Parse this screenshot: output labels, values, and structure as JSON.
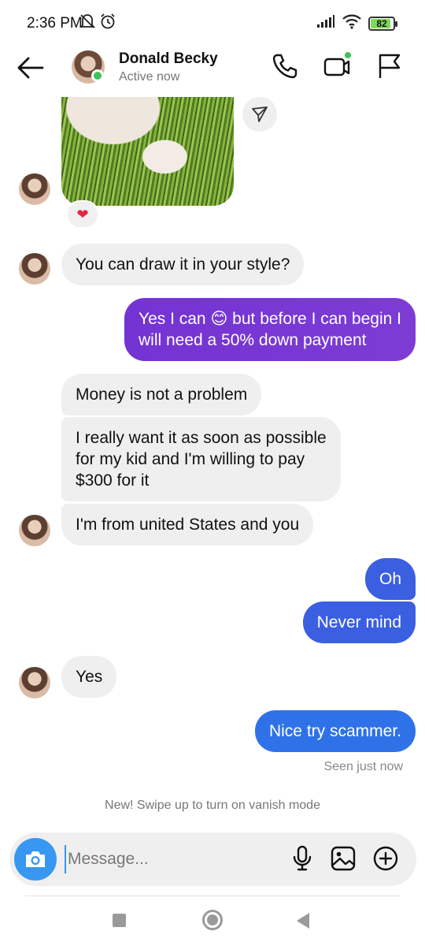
{
  "status_bar": {
    "time": "2:36 PM",
    "battery_level": "82",
    "battery_fraction": 0.82
  },
  "header": {
    "name": "Donald Becky",
    "status": "Active now"
  },
  "chat": {
    "reaction": "❤",
    "messages": [
      {
        "sender": "them",
        "text": "You can draw it in your style?"
      },
      {
        "sender": "me",
        "lines": [
          "Yes I can 😊 but before I can begin I",
          "will need a 50% down payment"
        ]
      },
      {
        "sender": "them",
        "text": "Money is not a problem"
      },
      {
        "sender": "them",
        "lines": [
          "I really want it as soon as possible",
          "for my kid and I'm willing to pay",
          "$300 for it"
        ]
      },
      {
        "sender": "them",
        "text": "I'm from united States and you"
      },
      {
        "sender": "me",
        "text": "Oh"
      },
      {
        "sender": "me",
        "text": "Never mind"
      },
      {
        "sender": "them",
        "text": "Yes"
      },
      {
        "sender": "me",
        "text": "Nice try scammer."
      }
    ],
    "seen_text": "Seen just now",
    "vanish_text": "New! Swipe up to turn on vanish mode"
  },
  "composer": {
    "placeholder": "Message...",
    "value": ""
  },
  "icons": {
    "status_left": [
      "mute-icon",
      "alarm-icon"
    ],
    "status_right": [
      "signal-icon",
      "wifi-icon",
      "battery-icon"
    ],
    "header": [
      "back-arrow-icon",
      "phone-icon",
      "video-icon",
      "flag-icon"
    ],
    "composer": [
      "camera-icon",
      "microphone-icon",
      "gallery-icon",
      "plus-circle-icon"
    ],
    "nav": [
      "recents-icon",
      "home-icon",
      "back-icon"
    ]
  },
  "colors": {
    "outgoing_purple": "#7433d3",
    "outgoing_blue": "#3a5fe0",
    "outgoing_blue_light": "#2f72e8",
    "incoming_gray": "#efefef",
    "online_green": "#3ac45a",
    "camera_blue": "#3897f0"
  }
}
